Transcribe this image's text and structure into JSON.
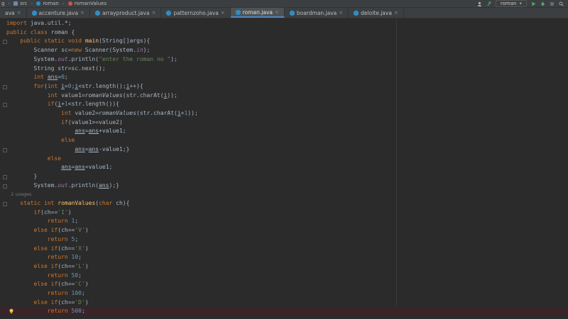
{
  "breadcrumb": {
    "items": [
      "g",
      "src",
      "roman",
      "romanValues"
    ]
  },
  "toolbar": {
    "run_config": "roman",
    "icons": [
      "user-icon",
      "hammer-icon",
      "run-icon",
      "debug-icon",
      "stop-icon",
      "search-icon"
    ]
  },
  "tabs": [
    {
      "label": "ava",
      "active": false
    },
    {
      "label": "accenture.java",
      "active": false
    },
    {
      "label": "arrayproduct.java",
      "active": false
    },
    {
      "label": "patternzoho.java",
      "active": false
    },
    {
      "label": "roman.java",
      "active": true
    },
    {
      "label": "boardman.java",
      "active": false
    },
    {
      "label": "deloite.java",
      "active": false
    }
  ],
  "editor": {
    "usage_hint": "2 usages",
    "lines": [
      "import java.util.*;",
      "public class roman {",
      "    public static void main(String[]args){",
      "        Scanner sc=new Scanner(System.in);",
      "        System.out.println(\"enter the roman no \");",
      "        String str=sc.next();",
      "        int ans=0;",
      "        for(int i=0;i<str.length();i++){",
      "            int value1=romanValues(str.charAt(i));",
      "            if(i+1<str.length()){",
      "                int value2=romanValues(str.charAt(i+1));",
      "                if(value1>=value2)",
      "                    ans=ans+value1;",
      "                else",
      "                    ans=ans-value1;}",
      "            else",
      "                ans=ans+value1;",
      "        }",
      "        System.out.println(ans);}",
      "2 usages",
      "    static int romanValues(char ch){",
      "        if(ch=='I')",
      "            return 1;",
      "        else if(ch=='V')",
      "            return 5;",
      "        else if(ch=='X')",
      "            return 10;",
      "        else if(ch=='L')",
      "            return 50;",
      "        else if(ch=='C')",
      "            return 100;",
      "        else if(ch=='D')",
      "            return 500;"
    ]
  },
  "colors": {
    "keyword": "#cc7832",
    "function": "#ffc66d",
    "string": "#6a8759",
    "number": "#6897bb",
    "field": "#9876aa",
    "highlight_line": "#3b2428"
  }
}
